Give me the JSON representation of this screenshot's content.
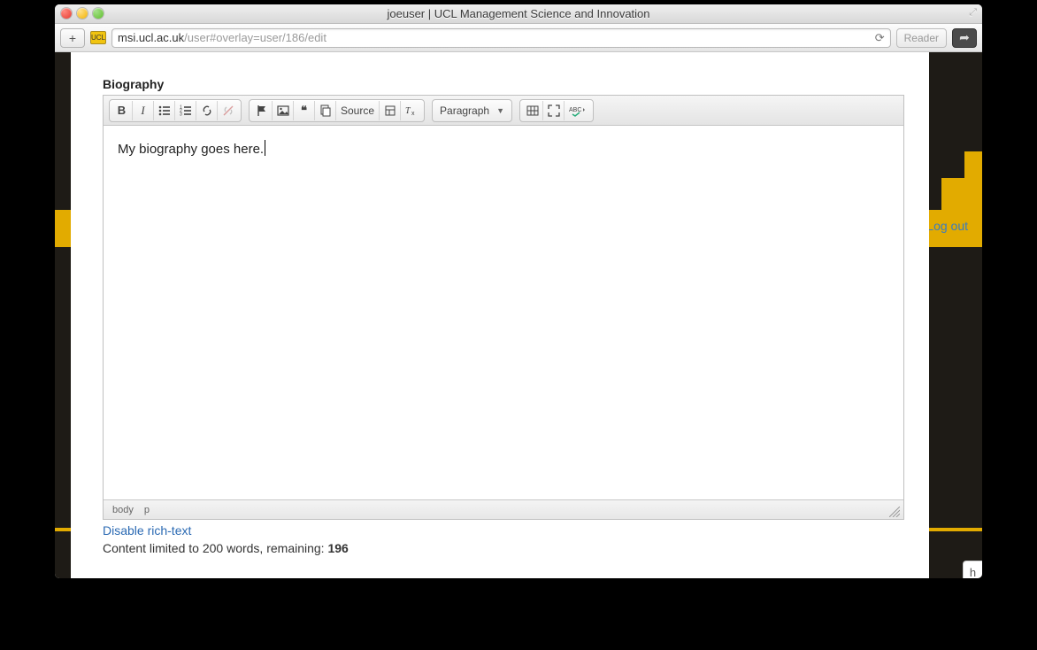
{
  "window": {
    "title": "joeuser | UCL Management Science and Innovation",
    "maximize_glyph": "⤢"
  },
  "urlbar": {
    "add_glyph": "+",
    "favicon_text": "UCL",
    "host": "msi.ucl.ac.uk",
    "path": "/user#overlay=user/186/edit",
    "reload_glyph": "⟳",
    "reader_label": "Reader",
    "share_glyph": "➦"
  },
  "background": {
    "logout": "Log out",
    "stub": "h"
  },
  "form": {
    "field_label": "Biography"
  },
  "editor": {
    "content": "My biography goes here.",
    "path_body": "body",
    "path_p": "p",
    "toolbar": {
      "bold": "B",
      "italic": "I",
      "ul_title": "Bulleted List",
      "ol_title": "Numbered List",
      "link_title": "Link",
      "unlink_title": "Unlink",
      "anchor_title": "Anchor",
      "image_title": "Image",
      "quote_glyph": "❝",
      "paste_title": "Paste from Word",
      "source": "Source",
      "template_title": "Templates",
      "removeformat_title": "Remove Format",
      "paragraph": "Paragraph",
      "table_title": "Table",
      "maximize_title": "Maximize",
      "spell_title": "Spell Check"
    }
  },
  "below": {
    "disable_link": "Disable rich-text",
    "limit_prefix": "Content limited to 200 words, remaining: ",
    "limit_remaining": "196"
  }
}
